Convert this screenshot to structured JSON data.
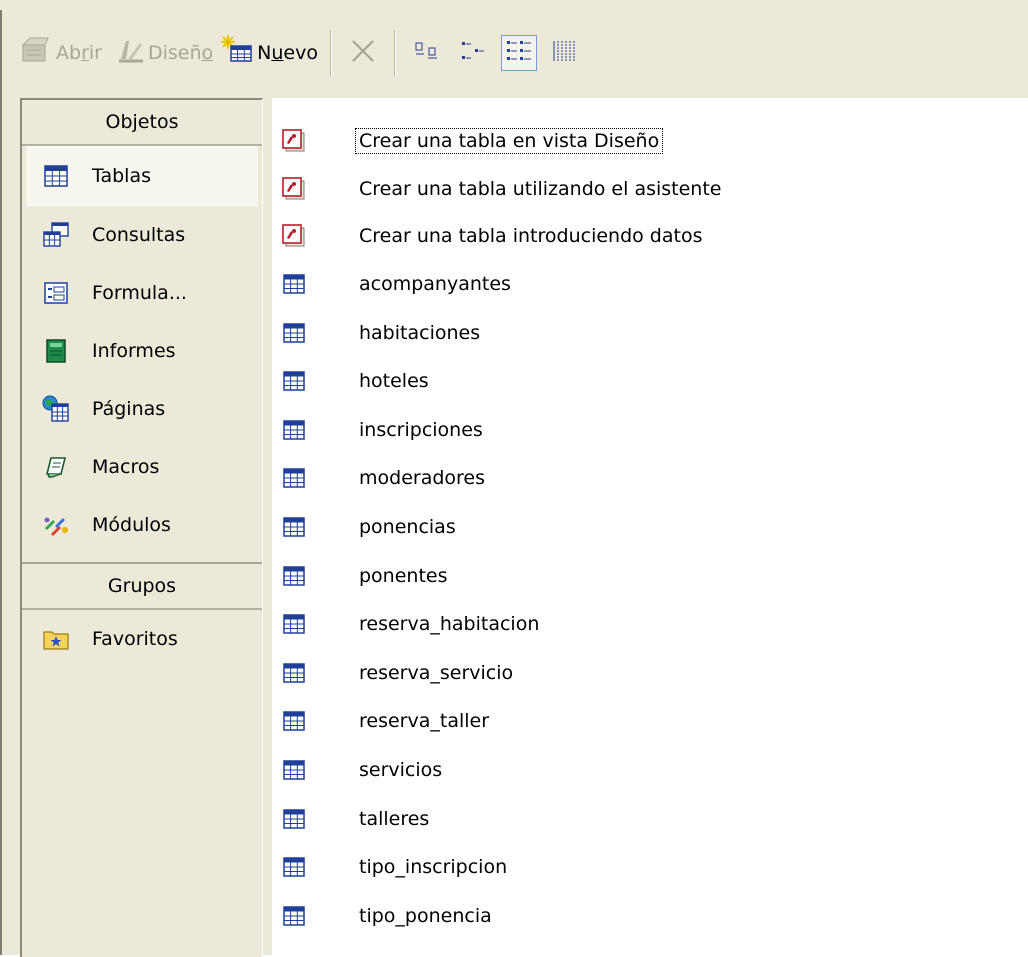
{
  "toolbar": {
    "abrir": {
      "pre": "Ab",
      "key": "r",
      "post": "ir"
    },
    "diseno": {
      "pre": "Diseñ",
      "key": "o",
      "post": ""
    },
    "nuevo": {
      "pre": "N",
      "key": "u",
      "post": "evo"
    }
  },
  "sidebar": {
    "objetos_header": "Objetos",
    "items": [
      {
        "label": "Tablas",
        "icon": "table-icon"
      },
      {
        "label": "Consultas",
        "icon": "query-icon"
      },
      {
        "label": "Formula...",
        "icon": "form-icon"
      },
      {
        "label": "Informes",
        "icon": "report-icon"
      },
      {
        "label": "Páginas",
        "icon": "page-icon"
      },
      {
        "label": "Macros",
        "icon": "macro-icon"
      },
      {
        "label": "Módulos",
        "icon": "module-icon"
      }
    ],
    "grupos_header": "Grupos",
    "groups": [
      {
        "label": "Favoritos",
        "icon": "favorites-icon"
      }
    ]
  },
  "list": {
    "shortcuts": [
      "Crear una tabla en vista Diseño",
      "Crear una tabla utilizando el asistente",
      "Crear una tabla introduciendo datos"
    ],
    "tables": [
      "acompanyantes",
      "habitaciones",
      "hoteles",
      "inscripciones",
      "moderadores",
      "ponencias",
      "ponentes",
      "reserva_habitacion",
      "reserva_servicio",
      "reserva_taller",
      "servicios",
      "talleres",
      "tipo_inscripcion",
      "tipo_ponencia"
    ]
  },
  "colors": {
    "face": "#ece9d8",
    "accent_blue": "#1f3f9a",
    "shortcut_red": "#b2202a"
  }
}
